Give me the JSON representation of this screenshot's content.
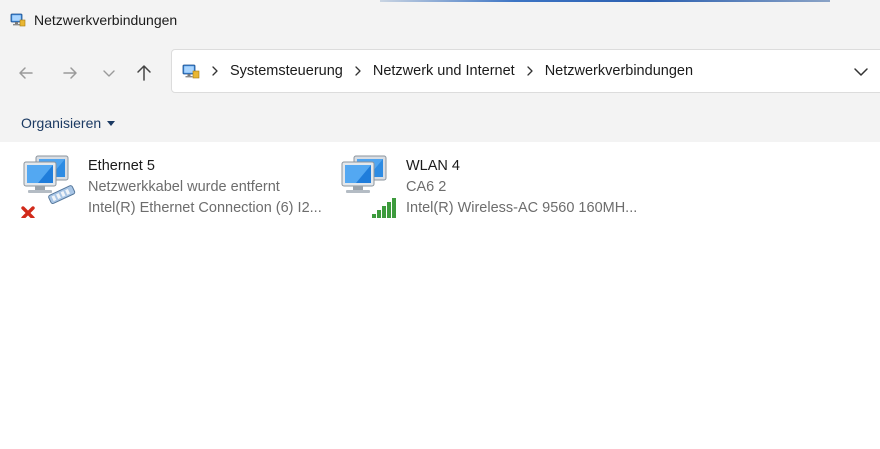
{
  "window": {
    "title": "Netzwerkverbindungen"
  },
  "nav": {
    "back": "back-arrow",
    "forward": "forward-arrow",
    "recent": "chevron-down",
    "up": "up-arrow"
  },
  "address": {
    "crumbs": [
      "Systemsteuerung",
      "Netzwerk und Internet",
      "Netzwerkverbindungen"
    ]
  },
  "command": {
    "organize_label": "Organisieren"
  },
  "connections": [
    {
      "name": "Ethernet 5",
      "status": "Netzwerkkabel wurde entfernt",
      "device": "Intel(R) Ethernet Connection (6) I2...",
      "icon": "ethernet-disconnected-icon"
    },
    {
      "name": "WLAN 4",
      "status": "CA6 2",
      "device": "Intel(R) Wireless-AC 9560 160MH...",
      "icon": "wifi-signal-icon"
    }
  ],
  "colors": {
    "chrome": "#f3f3f3",
    "accent": "#1b3a63",
    "secondary_text": "#6d6d6d"
  }
}
